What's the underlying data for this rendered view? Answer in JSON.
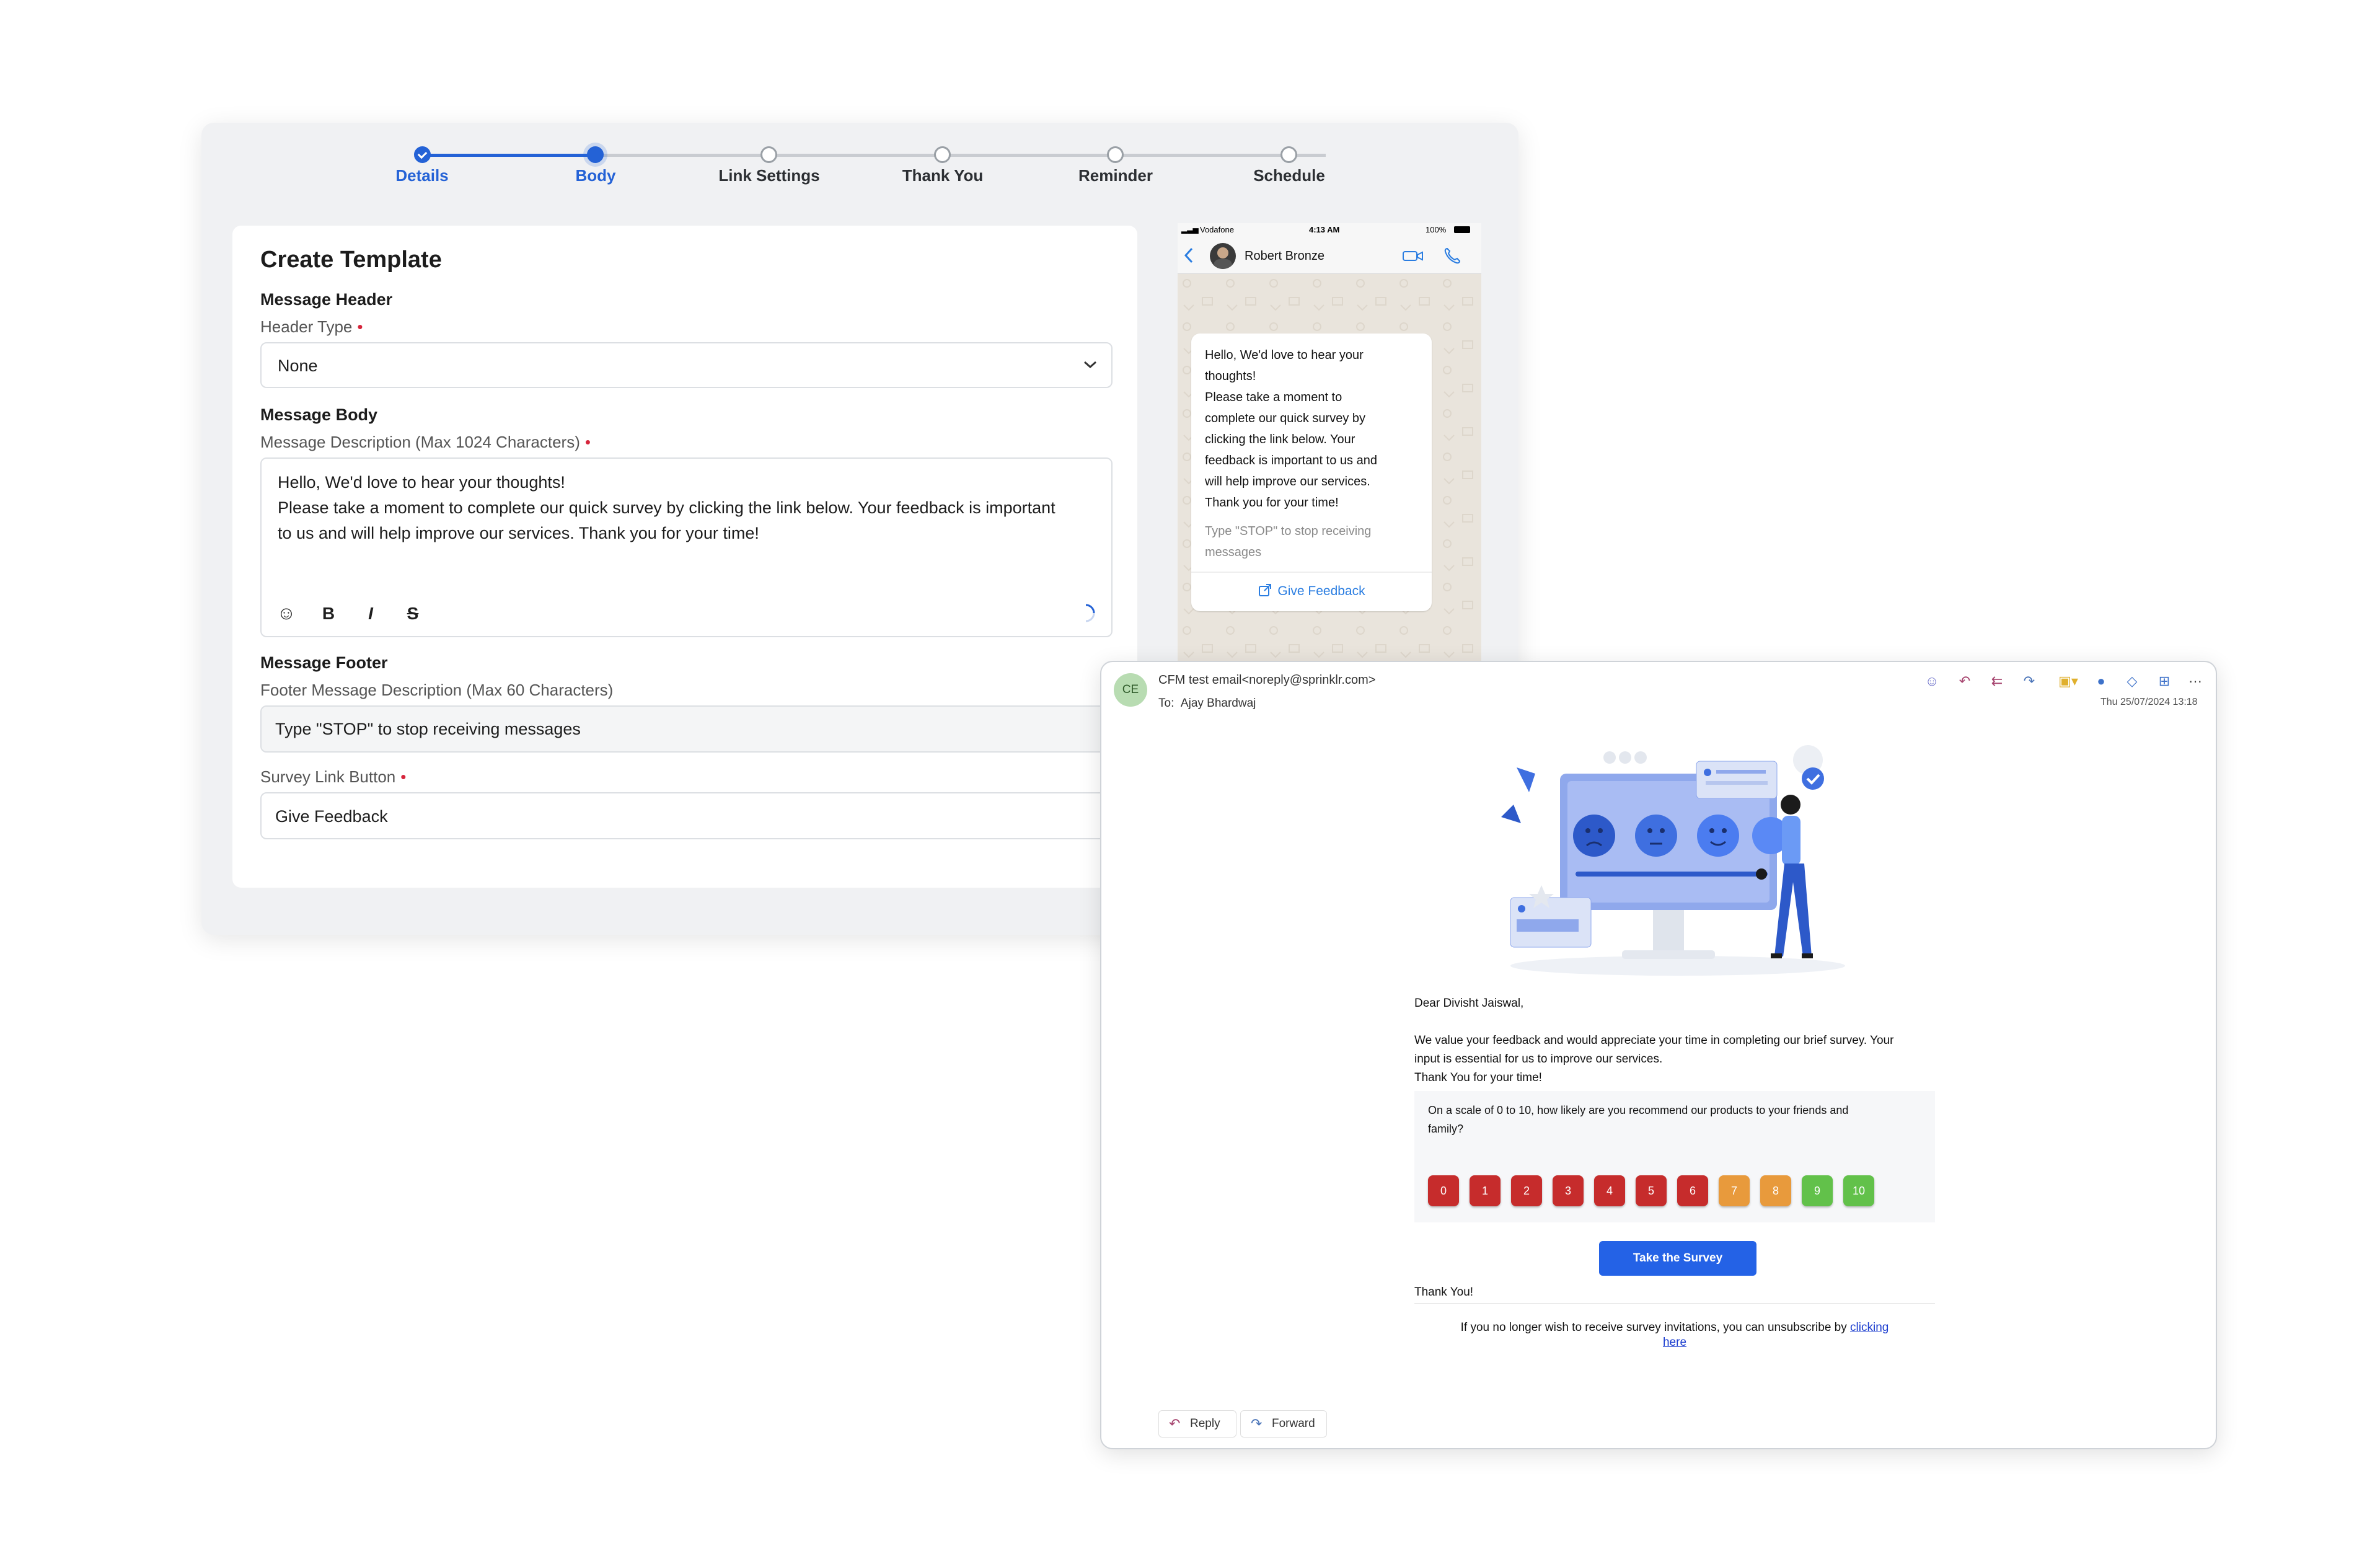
{
  "colors": {
    "accent": "#2462d6",
    "score_red": "#c62c2c",
    "score_orange": "#e89a3c",
    "score_green": "#62c14a"
  },
  "stepper": {
    "steps": [
      {
        "label": "Details",
        "state": "done"
      },
      {
        "label": "Body",
        "state": "active"
      },
      {
        "label": "Link Settings",
        "state": "pending"
      },
      {
        "label": "Thank You",
        "state": "pending"
      },
      {
        "label": "Reminder",
        "state": "pending"
      },
      {
        "label": "Schedule",
        "state": "pending"
      }
    ]
  },
  "form": {
    "title": "Create Template",
    "header_section": "Message Header",
    "header_type_label": "Header Type",
    "header_type_value": "None",
    "body_section": "Message Body",
    "description_label": "Message Description (Max 1024 Characters)",
    "description_line1": "Hello, We'd love to hear your thoughts!",
    "description_line2": "Please take a moment to complete our quick survey by clicking the link below. Your feedback is important",
    "description_line3": "to us and will help improve our services. Thank you for your time!",
    "toolbar": {
      "emoji": "☺",
      "bold": "B",
      "italic": "I",
      "strike": "S"
    },
    "footer_section": "Message Footer",
    "footer_label": "Footer Message Description (Max 60 Characters)",
    "footer_value": "Type \"STOP\" to stop receiving messages",
    "survey_button_label": "Survey Link Button",
    "survey_button_value": "Give Feedback",
    "required_mark": "•"
  },
  "phone": {
    "carrier": "Vodafone",
    "time": "4:13 AM",
    "battery": "100%",
    "contact": "Robert Bronze",
    "bubble_lines": [
      "Hello, We'd love to hear your",
      "thoughts!",
      "Please take a moment to",
      "complete our quick survey by",
      "clicking the link below. Your",
      "feedback is important to us and",
      "will help improve our services.",
      "Thank you for your time!"
    ],
    "footer_lines": [
      "Type \"STOP\" to stop receiving",
      "messages"
    ],
    "link_button": "Give Feedback"
  },
  "email": {
    "avatar_initials": "CE",
    "from": "CFM test email<noreply@sprinklr.com>",
    "to_label": "To:",
    "to_name": "Ajay Bhardwaj",
    "date": "Thu 25/07/2024 13:18",
    "greeting": "Dear Divisht Jaiswal,",
    "body_line1": "We value your feedback and would appreciate your time in completing our brief survey. Your",
    "body_line2": "input is essential for us to improve our services.",
    "body_line3": "Thank You for your time!",
    "question_line1": "On a scale of 0 to 10, how likely are you recommend our products to your friends and",
    "question_line2": "family?",
    "scores": [
      "0",
      "1",
      "2",
      "3",
      "4",
      "5",
      "6",
      "7",
      "8",
      "9",
      "10"
    ],
    "cta": "Take the Survey",
    "thanks": "Thank You!",
    "unsub_text": "If you no longer wish to receive survey invitations, you can unsubscribe by",
    "unsub_link1": "clicking",
    "unsub_link2": "here",
    "reply": "Reply",
    "forward": "Forward",
    "more": "···"
  }
}
